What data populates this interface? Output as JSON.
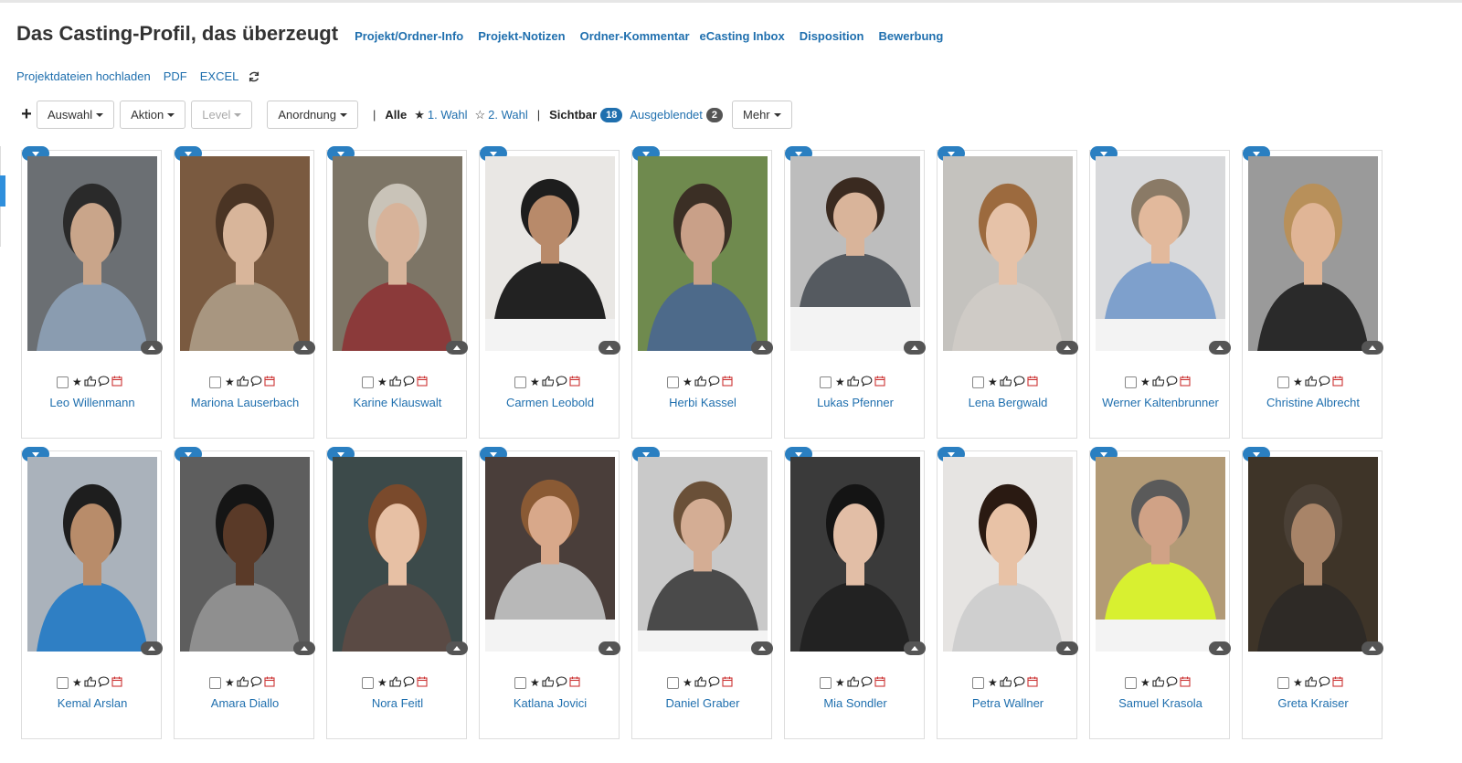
{
  "header": {
    "title": "Das Casting-Profil, das überzeugt",
    "links": [
      "Projekt/Ordner-Info",
      "Projekt-Notizen",
      "Ordner-Kommentar",
      "eCasting Inbox",
      "Disposition",
      "Bewerbung"
    ]
  },
  "subrow": {
    "upload": "Projektdateien hochladen",
    "pdf": "PDF",
    "excel": "EXCEL"
  },
  "toolbar": {
    "plus": "+",
    "auswahl": "Auswahl",
    "aktion": "Aktion",
    "level": "Level",
    "anordnung": "Anordnung",
    "alle": "Alle",
    "wahl1": "1. Wahl",
    "wahl2": "2. Wahl",
    "sichtbar": "Sichtbar",
    "sichtbar_count": "18",
    "ausgeblendet": "Ausgeblendet",
    "ausgeblendet_count": "2",
    "mehr": "Mehr"
  },
  "icons": {
    "star": "★",
    "thumb": "👍",
    "comment": "💬",
    "calendar": "📅"
  },
  "colors": {
    "link": "#1f6fae",
    "tab": "#2a7fc1",
    "badge": "#1f6fae"
  },
  "profiles": [
    {
      "name": "Leo Willenmann",
      "bg": "#6b6f73",
      "skin": "#c9a58a",
      "hair": "#2a2a2a",
      "shirt": "#8a9cb0"
    },
    {
      "name": "Mariona Lauserbach",
      "bg": "#7a5a40",
      "skin": "#d8b59a",
      "hair": "#4a3424",
      "shirt": "#a89680"
    },
    {
      "name": "Karine Klauswalt",
      "bg": "#7d7566",
      "skin": "#d7b39a",
      "hair": "#c9c3b8",
      "shirt": "#8b3a3a"
    },
    {
      "name": "Carmen Leobold",
      "bg": "#e9e7e4",
      "skin": "#b88a6a",
      "hair": "#1d1d1d",
      "shirt": "#222222"
    },
    {
      "name": "Herbi Kassel",
      "bg": "#6f8a4e",
      "skin": "#c9a088",
      "hair": "#3b2f25",
      "shirt": "#4d6a8a"
    },
    {
      "name": "Lukas Pfenner",
      "bg": "#bdbdbd",
      "skin": "#d9b49a",
      "hair": "#3a2a20",
      "shirt": "#555a60"
    },
    {
      "name": "Lena Bergwald",
      "bg": "#c4c2be",
      "skin": "#e6c2a8",
      "hair": "#9c6a3e",
      "shirt": "#cfcbc6"
    },
    {
      "name": "Werner Kaltenbrunner",
      "bg": "#d8d9db",
      "skin": "#e2b99c",
      "hair": "#8a7a66",
      "shirt": "#7ea0cc"
    },
    {
      "name": "Christine Albrecht",
      "bg": "#9a9a9a",
      "skin": "#e0b596",
      "hair": "#b8905a",
      "shirt": "#2a2a2a"
    },
    {
      "name": "Kemal Arslan",
      "bg": "#aab2bb",
      "skin": "#b88c6a",
      "hair": "#1e1e1e",
      "shirt": "#2f7fc4"
    },
    {
      "name": "Amara Diallo",
      "bg": "#5e5e5e",
      "skin": "#5a3a28",
      "hair": "#151515",
      "shirt": "#8f8f8f"
    },
    {
      "name": "Nora Feitl",
      "bg": "#3c4a4a",
      "skin": "#e7c0a4",
      "hair": "#7a4a2c",
      "shirt": "#5a4a44"
    },
    {
      "name": "Katlana Jovici",
      "bg": "#4a3e3a",
      "skin": "#d8a88a",
      "hair": "#8a5a34",
      "shirt": "#b8b8b8"
    },
    {
      "name": "Daniel Graber",
      "bg": "#c9c9c9",
      "skin": "#d4ad94",
      "hair": "#6a5038",
      "shirt": "#4a4a4a"
    },
    {
      "name": "Mia Sondler",
      "bg": "#3a3a3a",
      "skin": "#e2bea6",
      "hair": "#141414",
      "shirt": "#222222"
    },
    {
      "name": "Petra Wallner",
      "bg": "#e6e4e2",
      "skin": "#e8c2a6",
      "hair": "#2a1a12",
      "shirt": "#cfcfcf"
    },
    {
      "name": "Samuel Krasola",
      "bg": "#b29a76",
      "skin": "#d0a286",
      "hair": "#5a5a5a",
      "shirt": "#d8f030"
    },
    {
      "name": "Greta Kraiser",
      "bg": "#3e3428",
      "skin": "#a88468",
      "hair": "#4a4036",
      "shirt": "#2e2a26"
    }
  ]
}
